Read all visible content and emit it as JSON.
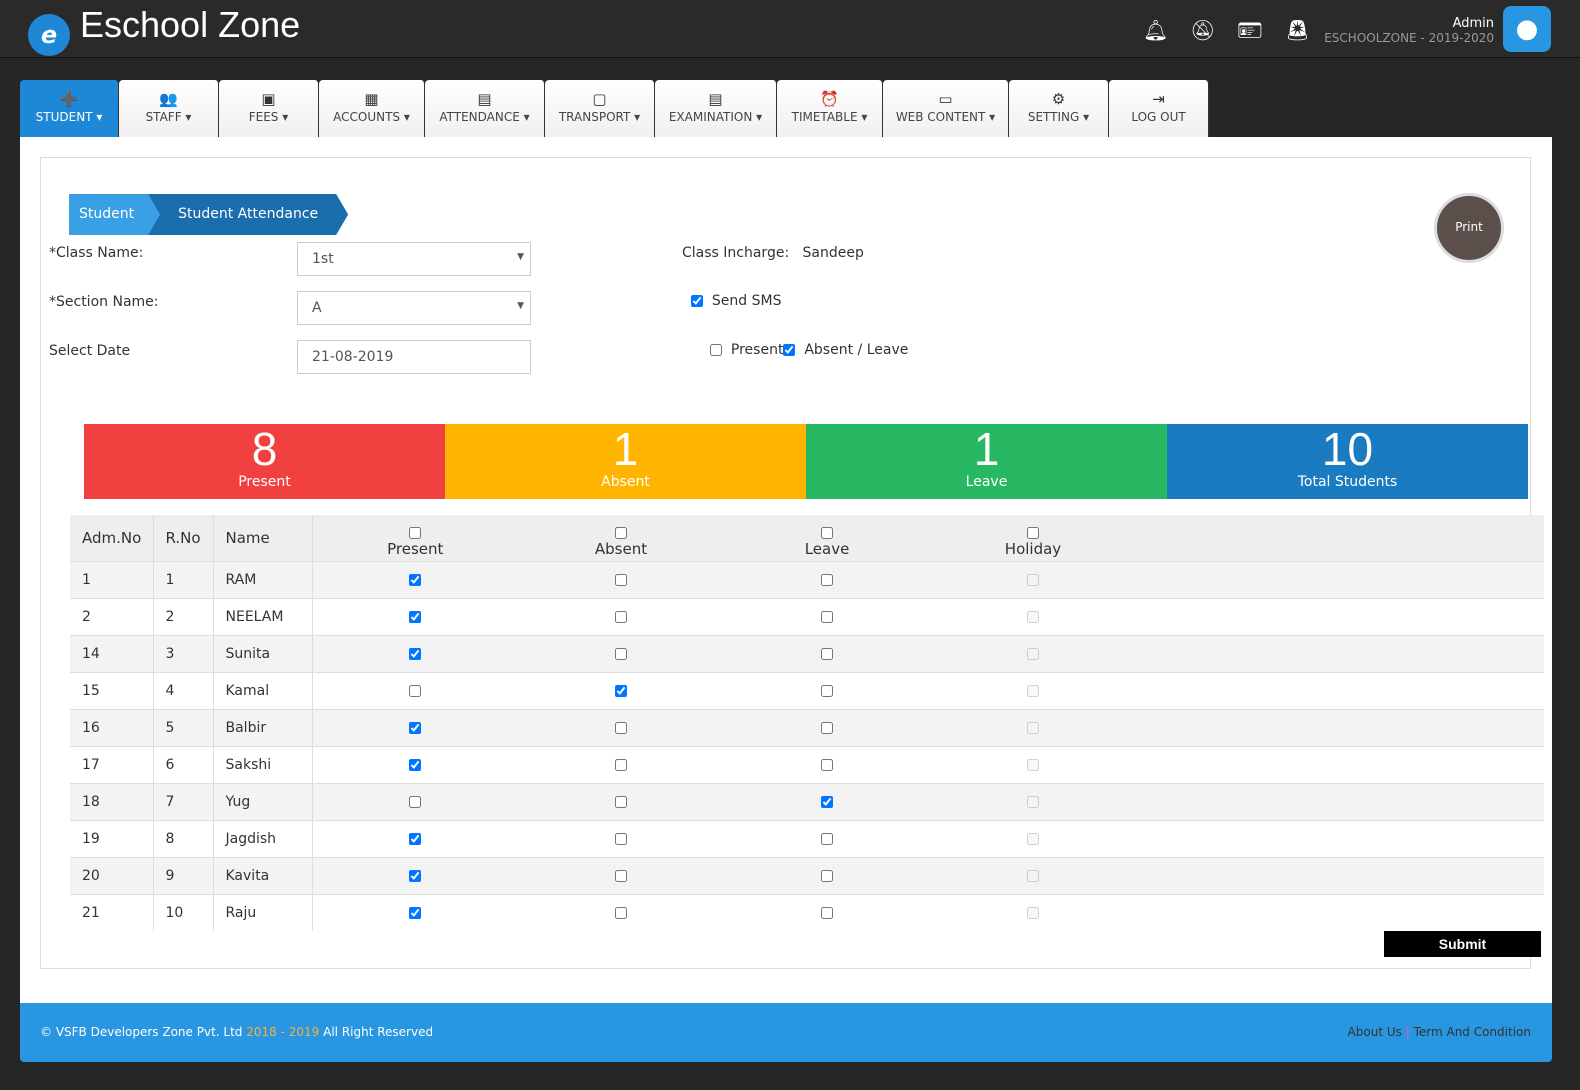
{
  "header": {
    "brand": "Eschool Zone",
    "logo_letter": "e",
    "user": "Admin",
    "session": "ESCHOOLZONE - 2019-2020",
    "icons": [
      "bell-icon",
      "bell-slash-icon",
      "id-card-icon",
      "alarm-icon",
      "user-circle-icon"
    ]
  },
  "nav": [
    {
      "label": "STUDENT ▾",
      "icon": "➕"
    },
    {
      "label": "STAFF ▾",
      "icon": "👥"
    },
    {
      "label": "FEES ▾",
      "icon": "▣"
    },
    {
      "label": "ACCOUNTS ▾",
      "icon": "▦"
    },
    {
      "label": "ATTENDANCE ▾",
      "icon": "▤"
    },
    {
      "label": "TRANSPORT ▾",
      "icon": "▢"
    },
    {
      "label": "EXAMINATION ▾",
      "icon": "▤"
    },
    {
      "label": "TIMETABLE ▾",
      "icon": "⏰"
    },
    {
      "label": "WEB CONTENT ▾",
      "icon": "▭"
    },
    {
      "label": "SETTING ▾",
      "icon": "⚙"
    },
    {
      "label": "LOG OUT",
      "icon": "⇥"
    }
  ],
  "breadcrumb": [
    "Student",
    "Student Attendance"
  ],
  "print_label": "Print",
  "form": {
    "class_label": "*Class Name:",
    "class_value": "1st",
    "section_label": "*Section Name:",
    "section_value": "A",
    "date_label": "Select Date",
    "date_value": "21-08-2019",
    "incharge_label": "Class Incharge:",
    "incharge_value": "Sandeep",
    "sms_label": "Send SMS",
    "sms_checked": true,
    "present_label": "Present",
    "present_checked": false,
    "absent_leave_label": "Absent / Leave",
    "absent_leave_checked": true
  },
  "stats": [
    {
      "value": "8",
      "label": "Present",
      "color": "#f04040"
    },
    {
      "value": "1",
      "label": "Absent",
      "color": "#ffb400"
    },
    {
      "value": "1",
      "label": "Leave",
      "color": "#28b864"
    },
    {
      "value": "10",
      "label": "Total Students",
      "color": "#1a7bc0"
    }
  ],
  "table": {
    "headers": [
      "Adm.No",
      "R.No",
      "Name",
      "Present",
      "Absent",
      "Leave",
      "Holiday"
    ],
    "rows": [
      {
        "adm": "1",
        "rno": "1",
        "name": "RAM",
        "status": "Present"
      },
      {
        "adm": "2",
        "rno": "2",
        "name": "NEELAM",
        "status": "Present"
      },
      {
        "adm": "14",
        "rno": "3",
        "name": "Sunita",
        "status": "Present"
      },
      {
        "adm": "15",
        "rno": "4",
        "name": "Kamal",
        "status": "Absent"
      },
      {
        "adm": "16",
        "rno": "5",
        "name": "Balbir",
        "status": "Present"
      },
      {
        "adm": "17",
        "rno": "6",
        "name": "Sakshi",
        "status": "Present"
      },
      {
        "adm": "18",
        "rno": "7",
        "name": "Yug",
        "status": "Leave"
      },
      {
        "adm": "19",
        "rno": "8",
        "name": "Jagdish",
        "status": "Present"
      },
      {
        "adm": "20",
        "rno": "9",
        "name": "Kavita",
        "status": "Present"
      },
      {
        "adm": "21",
        "rno": "10",
        "name": "Raju",
        "status": "Present"
      }
    ]
  },
  "submit_label": "Submit",
  "footer": {
    "copyright": "© VSFB Developers Zone Pvt. Ltd",
    "years": "2018 - 2019",
    "rights": "All Right Reserved",
    "about": "About Us",
    "sep": "|",
    "terms": "Term And Condition"
  }
}
